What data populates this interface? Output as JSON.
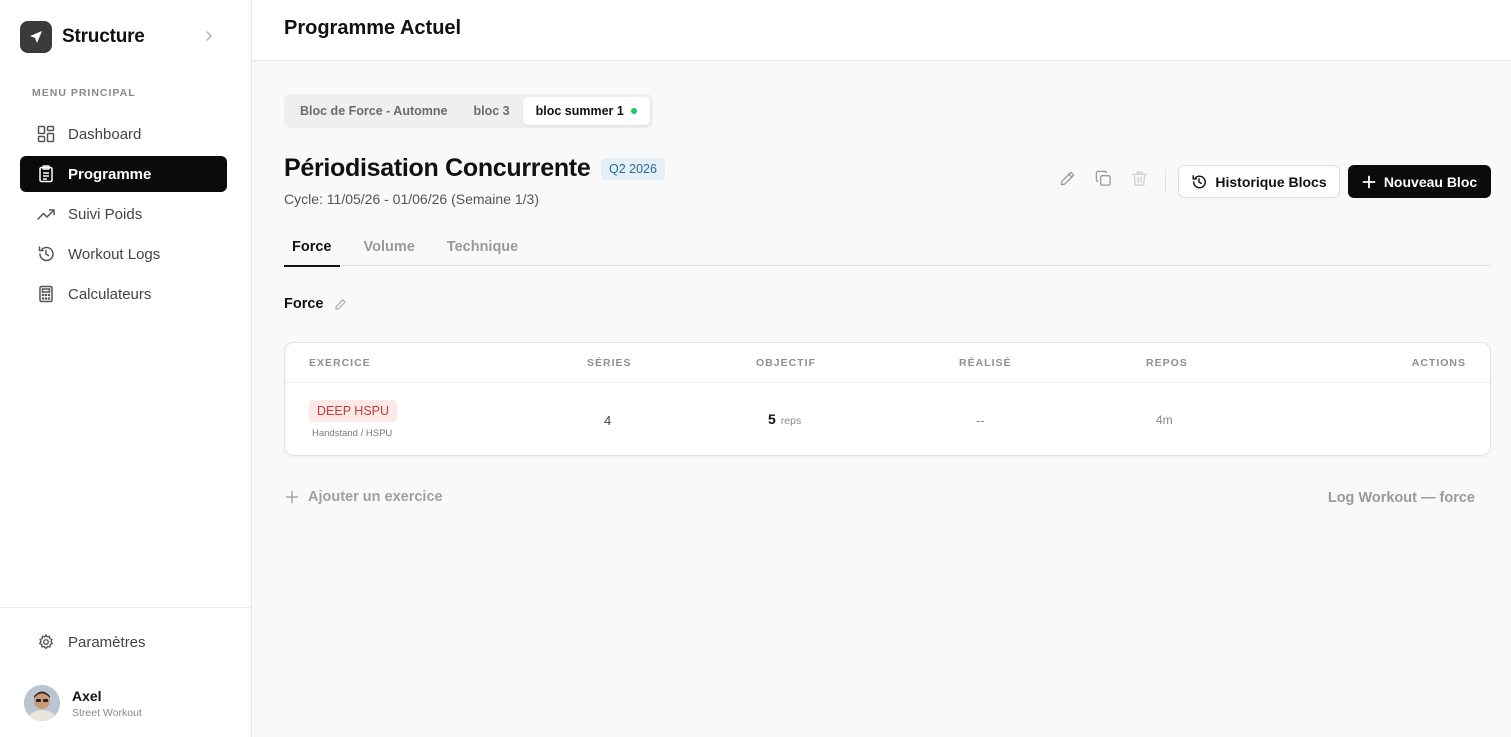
{
  "brand": {
    "name": "Structure",
    "logo_icon": "send-icon"
  },
  "sidebar": {
    "menu_heading": "MENU PRINCIPAL",
    "items": [
      {
        "label": "Dashboard",
        "icon": "grid-icon"
      },
      {
        "label": "Programme",
        "icon": "clipboard-icon",
        "active": true
      },
      {
        "label": "Suivi Poids",
        "icon": "trending-up-icon"
      },
      {
        "label": "Workout Logs",
        "icon": "history-icon"
      },
      {
        "label": "Calculateurs",
        "icon": "calculator-icon"
      }
    ],
    "settings_label": "Paramètres"
  },
  "user": {
    "name": "Axel",
    "role": "Street Workout"
  },
  "header": {
    "title": "Programme Actuel"
  },
  "block_tabs": [
    {
      "label": "Bloc de Force - Automne"
    },
    {
      "label": "bloc 3"
    },
    {
      "label": "bloc summer 1",
      "active": true
    }
  ],
  "program": {
    "title": "Périodisation Concurrente",
    "quarter": "Q2 2026",
    "cycle": "Cycle: 11/05/26 - 01/06/26 (Semaine 1/3)"
  },
  "actions": {
    "history_label": "Historique Blocs",
    "new_label": "Nouveau Bloc"
  },
  "session_tabs": [
    {
      "label": "Force",
      "active": true
    },
    {
      "label": "Volume"
    },
    {
      "label": "Technique"
    }
  ],
  "section": {
    "label": "Force"
  },
  "table": {
    "headers": {
      "exercise": "EXERCICE",
      "series": "SÉRIES",
      "objective": "OBJECTIF",
      "done": "RÉALISÉ",
      "rest": "REPOS",
      "actions": "ACTIONS"
    },
    "rows": [
      {
        "exercise": "DEEP HSPU",
        "category": "Handstand / HSPU",
        "series": "4",
        "objective_value": "5",
        "objective_unit": "reps",
        "done": "--",
        "rest": "4m"
      }
    ]
  },
  "footer": {
    "add_exercise": "Ajouter un exercice",
    "log_workout": "Log Workout — force"
  },
  "colors": {
    "accent": "#0b0b0b",
    "active_dot": "#22c55e",
    "quarter_badge_bg": "#e4eff6",
    "exercise_badge_bg": "#fde8e8",
    "exercise_badge_text": "#c23a3a"
  }
}
